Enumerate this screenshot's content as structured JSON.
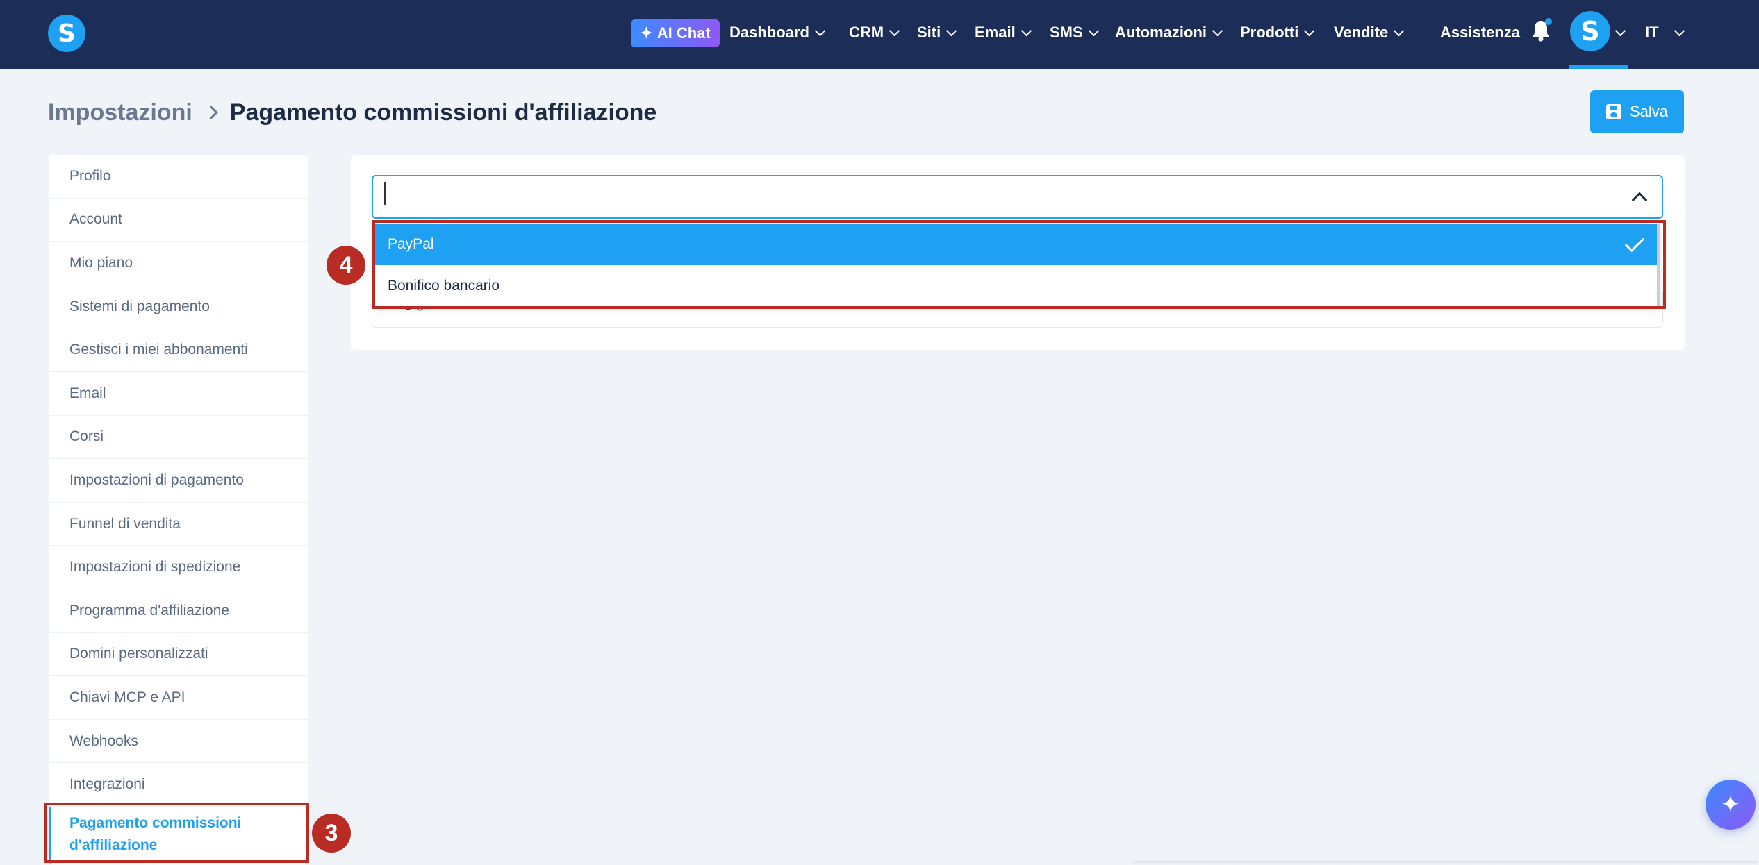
{
  "header": {
    "logo_letter": "S",
    "ai_chat_label": "AI Chat",
    "nav": [
      "Dashboard",
      "CRM",
      "Siti",
      "Email",
      "SMS",
      "Automazioni",
      "Prodotti",
      "Vendite"
    ],
    "help_label": "Assistenza",
    "avatar_letter": "S",
    "language": "IT"
  },
  "breadcrumb": {
    "parent": "Impostazioni",
    "current": "Pagamento commissioni d'affiliazione"
  },
  "toolbar": {
    "save_label": "Salva"
  },
  "sidebar": {
    "items": [
      "Profilo",
      "Account",
      "Mio piano",
      "Sistemi di pagamento",
      "Gestisci i miei abbonamenti",
      "Email",
      "Corsi",
      "Impostazioni di pagamento",
      "Funnel di vendita",
      "Impostazioni di spedizione",
      "Programma d'affiliazione",
      "Domini personalizzati",
      "Chiavi MCP e API",
      "Webhooks",
      "Integrazioni"
    ],
    "active_item": "Pagamento commissioni d'affiliazione"
  },
  "payment_method": {
    "options": [
      "PayPal",
      "Bonifico bancario"
    ],
    "selected": "PayPal",
    "obscured_field_value": "...@gmail.com"
  },
  "annotations": {
    "step_sidebar": "3",
    "step_dropdown": "4",
    "highlight_color": "#b82c24"
  },
  "colors": {
    "topbar": "#1c2e57",
    "accent": "#1ea1f2",
    "page_bg": "#f0f4f9"
  },
  "icons": [
    "sparkle-icon",
    "bell-icon",
    "save-icon",
    "check-icon",
    "chevron-up-icon",
    "chevron-down-icon",
    "assistant-fab-icon"
  ]
}
